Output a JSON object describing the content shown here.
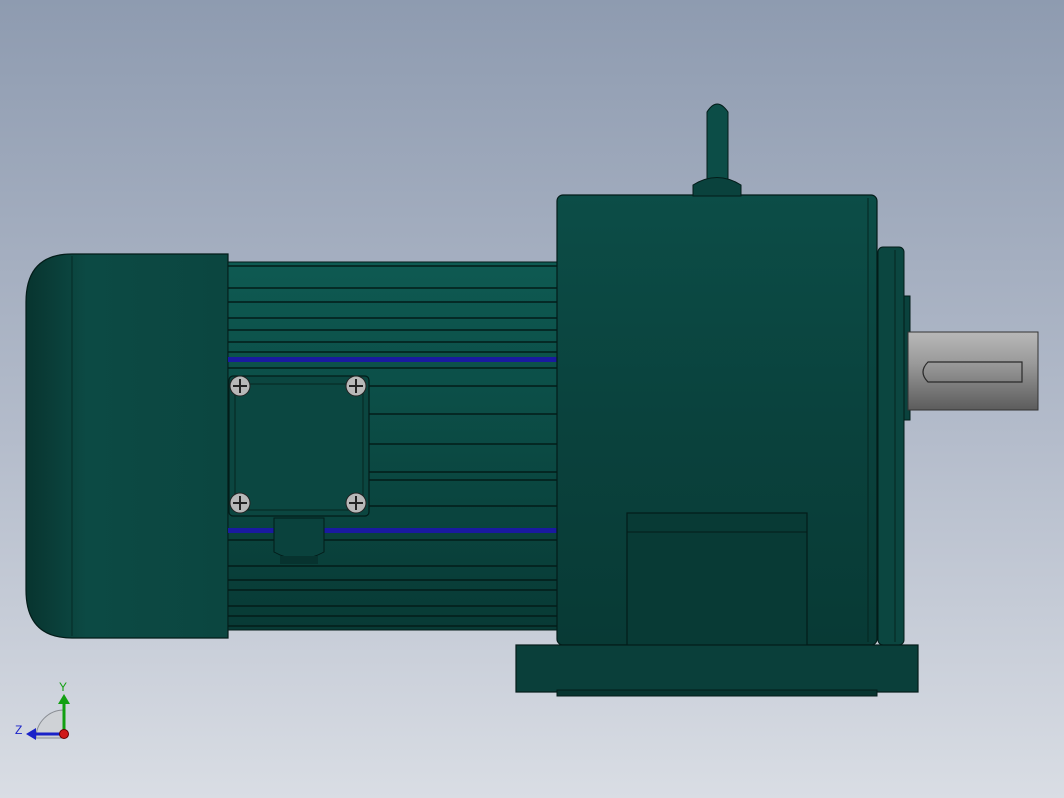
{
  "triad": {
    "y_label": "Y",
    "z_label": "Z",
    "y_color": "#12a012",
    "z_color": "#1a22c8",
    "origin_color": "#d01818"
  },
  "colors": {
    "motor_body": "#0b4a44",
    "motor_dark": "#07332f",
    "fin_stripe": "#1a1aa0",
    "shaft": "#8c8c8c"
  }
}
